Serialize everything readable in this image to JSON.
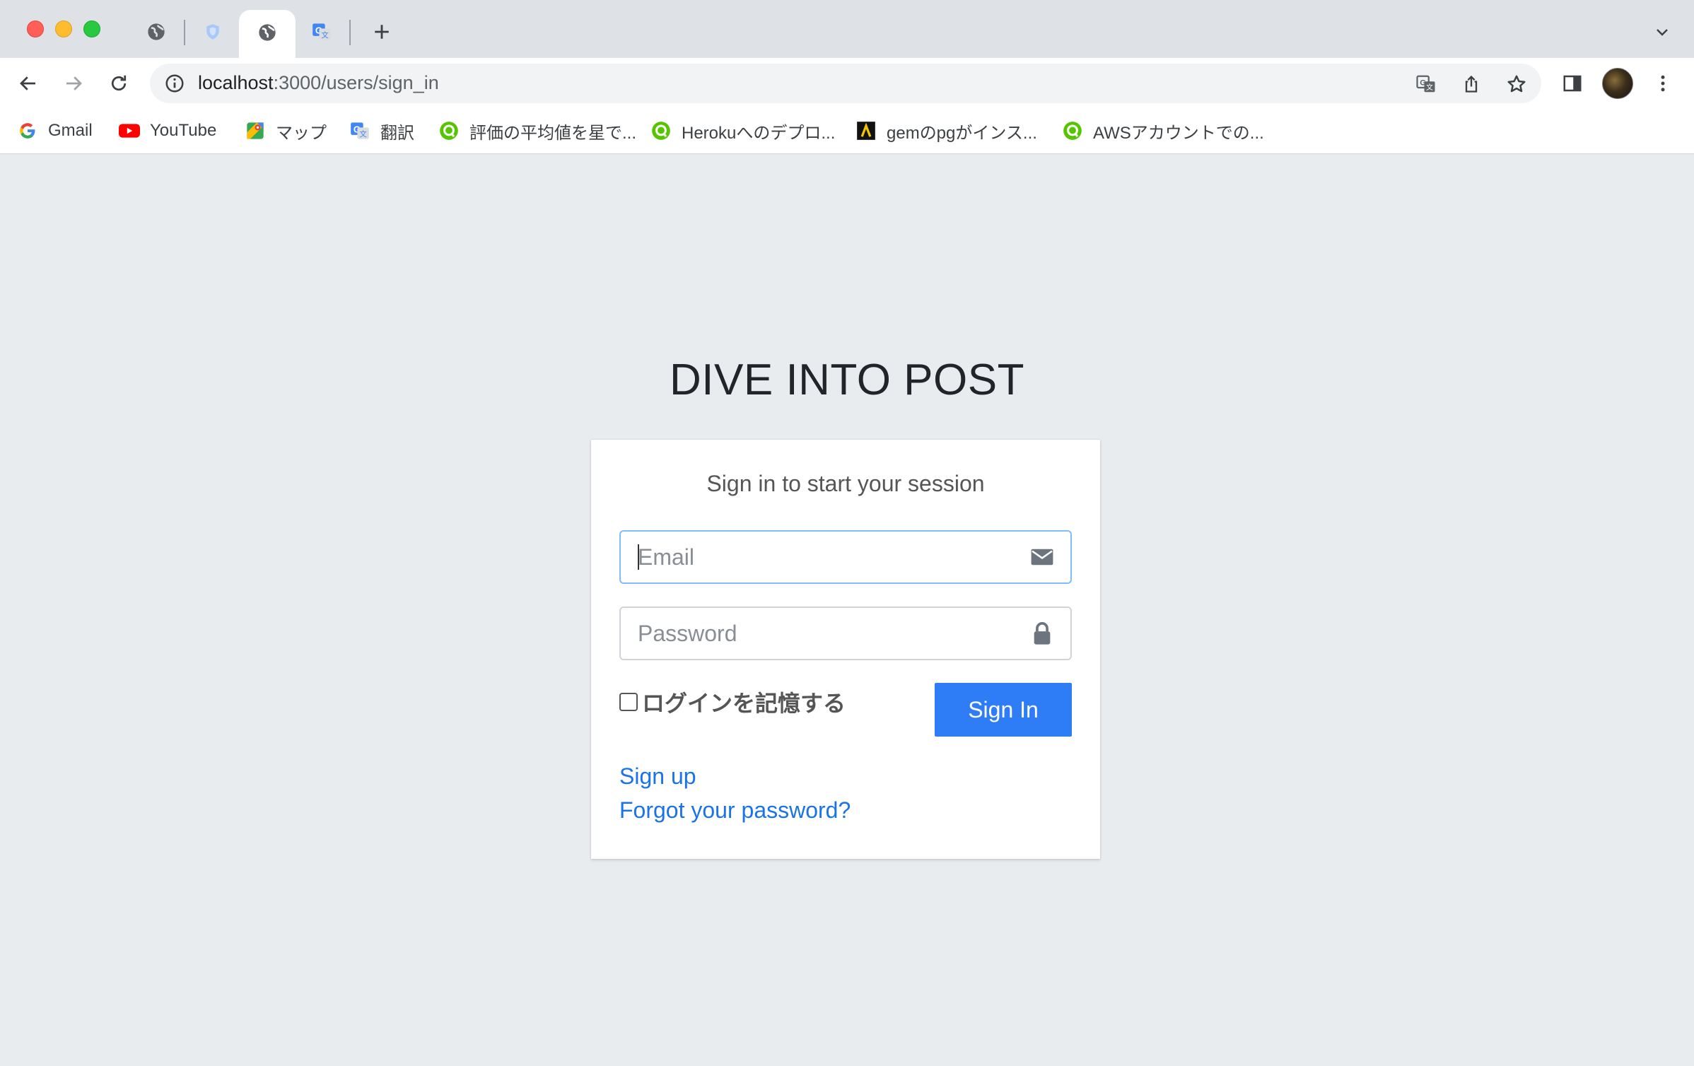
{
  "browser": {
    "url_host": "localhost",
    "url_path": ":3000/users/sign_in",
    "bookmarks": [
      {
        "label": "Gmail",
        "icon": "google-icon"
      },
      {
        "label": "YouTube",
        "icon": "youtube-icon"
      },
      {
        "label": "マップ",
        "icon": "maps-icon"
      },
      {
        "label": "翻訳",
        "icon": "translate-icon"
      },
      {
        "label": "評価の平均値を星で...",
        "icon": "qiita-icon"
      },
      {
        "label": "Herokuへのデプロ...",
        "icon": "qiita-icon"
      },
      {
        "label": "gemのpgがインス...",
        "icon": "zenn-icon"
      },
      {
        "label": "AWSアカウントでの...",
        "icon": "qiita-icon"
      }
    ]
  },
  "page": {
    "brand": "DIVE INTO POST",
    "login_message": "Sign in to start your session",
    "email_placeholder": "Email",
    "password_placeholder": "Password",
    "remember_label": "ログインを記憶する",
    "signin_label": "Sign In",
    "signup_link": "Sign up",
    "forgot_link": "Forgot your password?"
  },
  "colors": {
    "page_bg": "#e9ecef",
    "primary_button": "#2e7cf6",
    "link": "#1a73e8",
    "focus_border": "#80bdff"
  }
}
